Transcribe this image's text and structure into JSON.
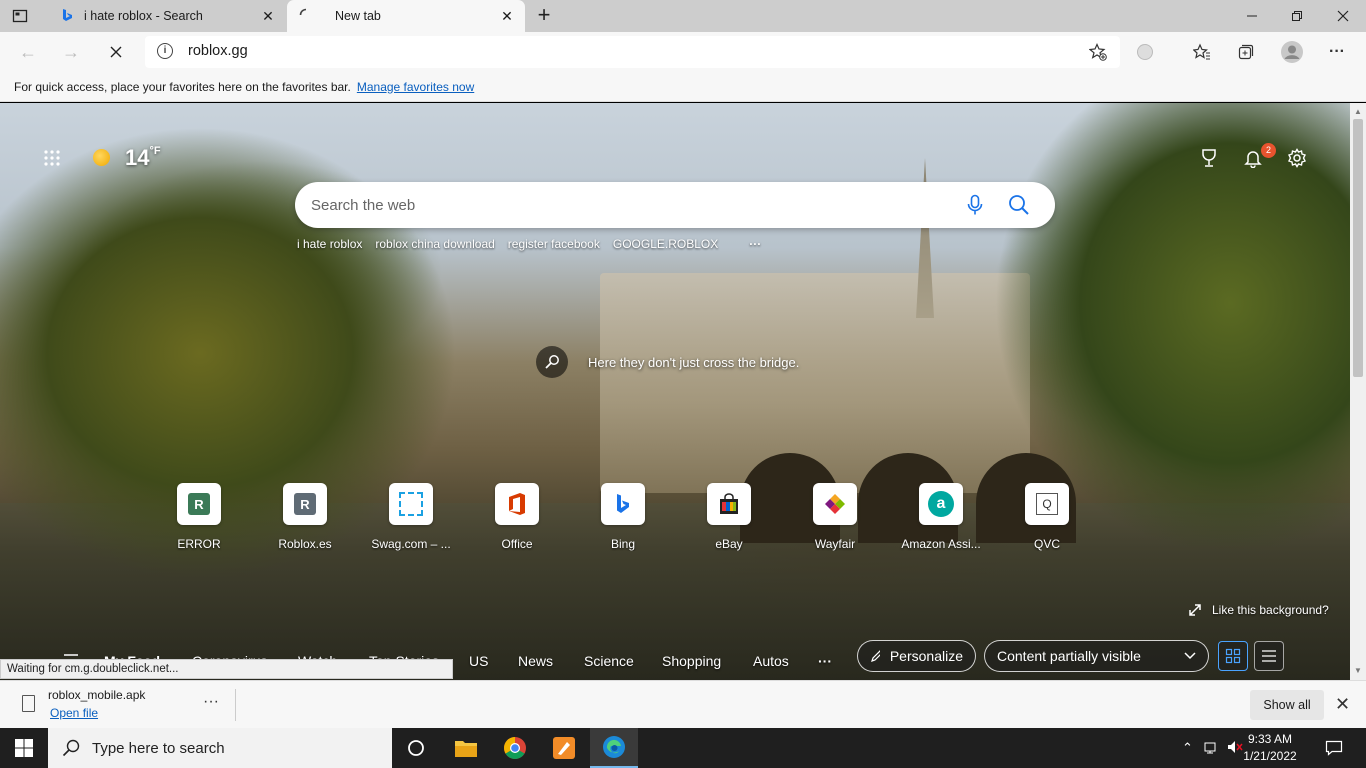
{
  "browser": {
    "tabs": [
      {
        "title": "i hate roblox - Search",
        "active": false
      },
      {
        "title": "New tab",
        "active": true
      }
    ],
    "address": {
      "url": "roblox.gg"
    },
    "favorites_bar": {
      "message": "For quick access, place your favorites here on the favorites bar.",
      "link": "Manage favorites now"
    }
  },
  "newtab": {
    "weather": {
      "temp": "14",
      "unit": "°F"
    },
    "notifications": {
      "count": "2"
    },
    "search": {
      "placeholder": "Search the web",
      "suggestions": [
        "i hate roblox",
        "roblox china download",
        "register facebook",
        "GOOGLE.ROBLOX"
      ]
    },
    "caption": "Here they don't just cross the bridge.",
    "tiles": [
      {
        "label": "ERROR",
        "letter": "R",
        "color": "#3b7a57"
      },
      {
        "label": "Roblox.es",
        "letter": "R",
        "color": "#5f6b75"
      },
      {
        "label": "Swag.com – ...",
        "letter": "",
        "color": "#1ba1e2"
      },
      {
        "label": "Office",
        "letter": "",
        "color": "#d83b01"
      },
      {
        "label": "Bing",
        "letter": "b",
        "color": "#1a73e8"
      },
      {
        "label": "eBay",
        "letter": "",
        "color": "#e53238"
      },
      {
        "label": "Wayfair",
        "letter": "",
        "color": "#7f187f"
      },
      {
        "label": "Amazon Assi...",
        "letter": "a",
        "color": "#00a8a0"
      },
      {
        "label": "QVC",
        "letter": "Q",
        "color": "#555555"
      }
    ],
    "like_background": "Like this background?",
    "feed": {
      "items": [
        "My Feed",
        "Coronavirus",
        "Watch",
        "Top Stories",
        "US",
        "News",
        "Science",
        "Shopping",
        "Autos"
      ],
      "more": "···",
      "personalize": "Personalize",
      "visibility": "Content partially visible"
    },
    "status": "Waiting for cm.g.doubleclick.net..."
  },
  "download": {
    "filename": "roblox_mobile.apk",
    "open_label": "Open file",
    "more": "···",
    "show_all": "Show all"
  },
  "taskbar": {
    "search_placeholder": "Type here to search",
    "time": "9:33 AM",
    "date": "1/21/2022"
  }
}
